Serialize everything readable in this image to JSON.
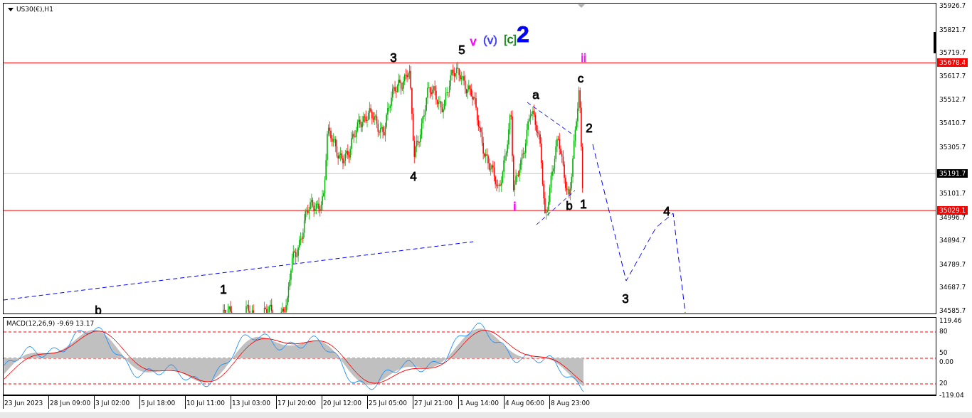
{
  "chart": {
    "symbol": "US30(€),H1",
    "price_axis": [
      "35926.7",
      "35821.7",
      "35719.7",
      "35617.7",
      "35512.7",
      "35410.7",
      "35305.7",
      "35101.7",
      "34996.7",
      "34894.7",
      "34789.7",
      "34687.7",
      "34585.7"
    ],
    "levels": [
      {
        "price": "35678.4",
        "color": "#ff0000"
      },
      {
        "price": "35191.7",
        "color": "#000000"
      },
      {
        "price": "35029.1",
        "color": "#ff0000"
      }
    ],
    "wave_labels": [
      {
        "text": "3",
        "color": "#000000",
        "kind": "minor"
      },
      {
        "text": "5",
        "color": "#000000",
        "kind": "minor"
      },
      {
        "text": "v",
        "color": "#ff00ff",
        "kind": "minor"
      },
      {
        "text": "(v)",
        "color": "#3333ff",
        "kind": "minor"
      },
      {
        "text": "[c]",
        "color": "#008000",
        "kind": "minor"
      },
      {
        "text": "2",
        "color": "#0000ff",
        "kind": "major"
      },
      {
        "text": "ii",
        "color": "#ff00ff",
        "kind": "minor"
      },
      {
        "text": "c",
        "color": "#000000",
        "kind": "minor"
      },
      {
        "text": "a",
        "color": "#000000",
        "kind": "minor"
      },
      {
        "text": "2",
        "color": "#000000",
        "kind": "minor"
      },
      {
        "text": "4",
        "color": "#000000",
        "kind": "minor"
      },
      {
        "text": "i",
        "color": "#ff00ff",
        "kind": "minor"
      },
      {
        "text": "b",
        "color": "#000000",
        "kind": "minor"
      },
      {
        "text": "1",
        "color": "#000000",
        "kind": "minor"
      },
      {
        "text": "4",
        "color": "#000000",
        "kind": "minor"
      },
      {
        "text": "3",
        "color": "#000000",
        "kind": "minor"
      },
      {
        "text": "1",
        "color": "#000000",
        "kind": "minor"
      },
      {
        "text": "b",
        "color": "#000000",
        "kind": "minor"
      }
    ]
  },
  "macd": {
    "title": "MACD(12,26,9) -9.69 13.17",
    "axis": [
      "119.46",
      "80",
      "50",
      "0.00",
      "20",
      "-119.04"
    ]
  },
  "time_axis": [
    "23 Jun 2023",
    "28 Jun 09:00",
    "3 Jul 02:00",
    "5 Jul 18:00",
    "10 Jul 11:00",
    "13 Jul 03:00",
    "17 Jul 20:00",
    "20 Jul 12:00",
    "25 Jul 05:00",
    "27 Jul 21:00",
    "1 Aug 14:00",
    "4 Aug 06:00",
    "8 Aug 23:00"
  ]
}
